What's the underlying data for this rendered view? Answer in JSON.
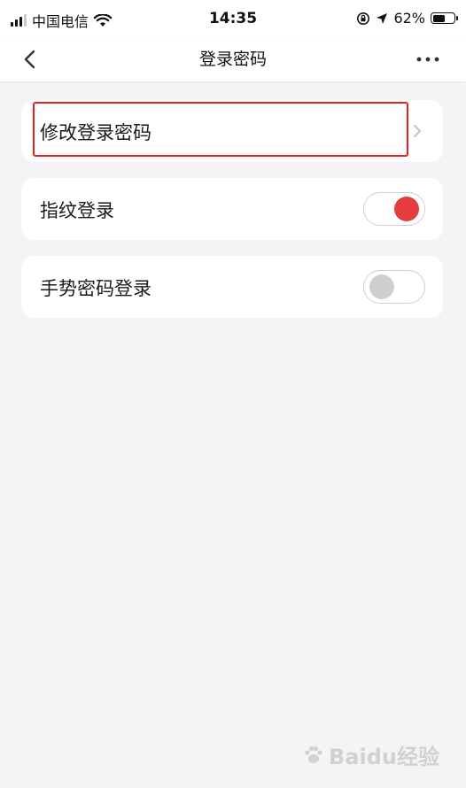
{
  "status_bar": {
    "carrier": "中国电信",
    "time": "14:35",
    "battery_percent": "62%",
    "battery_level": 0.62,
    "icons": [
      "signal-icon",
      "wifi-icon",
      "rotation-lock-icon",
      "location-arrow-icon",
      "battery-icon"
    ]
  },
  "nav": {
    "title": "登录密码",
    "back_icon": "chevron-left-icon",
    "more_icon": "more-dots-icon"
  },
  "settings": {
    "items": [
      {
        "label": "修改登录密码",
        "control": "chevron",
        "highlighted": true
      },
      {
        "label": "指纹登录",
        "control": "toggle",
        "enabled": true
      },
      {
        "label": "手势密码登录",
        "control": "toggle",
        "enabled": false
      }
    ]
  },
  "colors": {
    "accent_red": "#e53d3d",
    "highlight_border": "#e8211f",
    "toggle_off": "#cfcfcf",
    "background": "#f4f4f6"
  },
  "watermark": {
    "text": "Baidu经验"
  }
}
